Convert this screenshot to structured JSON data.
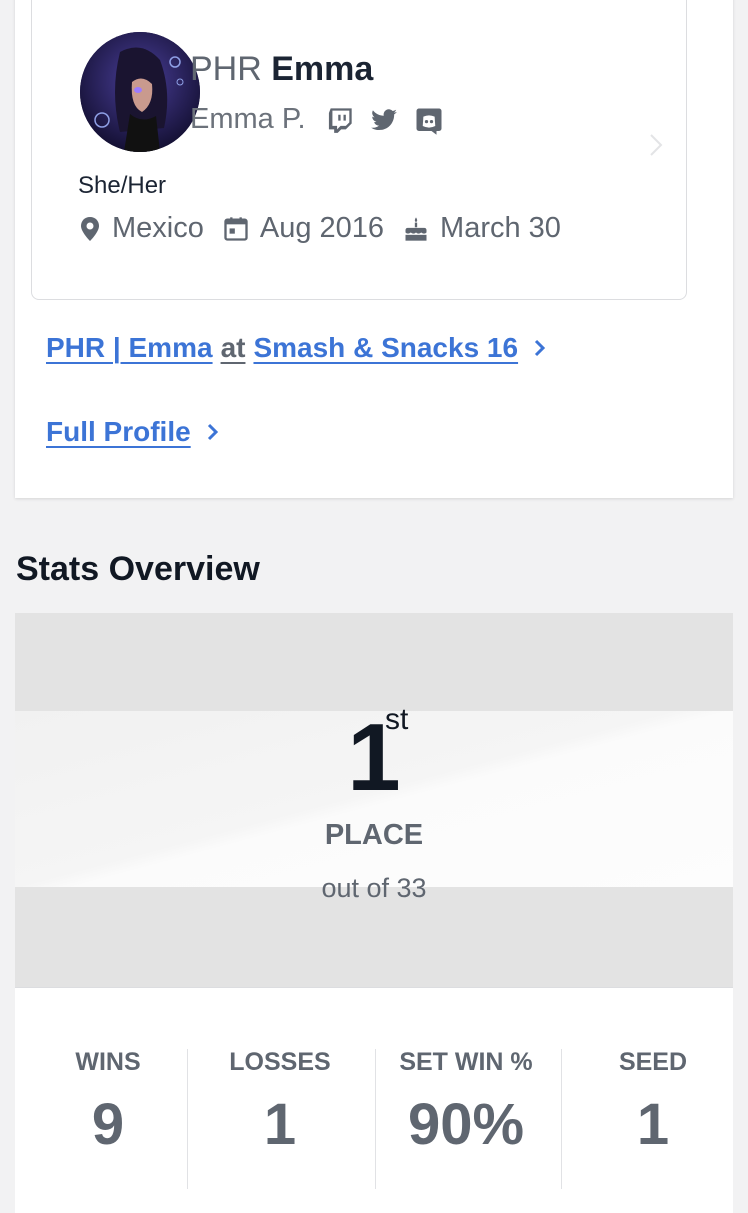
{
  "profile": {
    "prefix": "PHR",
    "gamertag": "Emma",
    "real_name": "Emma P.",
    "socials": [
      "twitch-icon",
      "twitter-icon",
      "discord-icon"
    ],
    "pronouns": "She/Her",
    "location": "Mexico",
    "joined": "Aug 2016",
    "birthday": "March 30"
  },
  "links": {
    "entrant_name": "PHR | Emma",
    "at": "at",
    "event_name": "Smash & Snacks 16",
    "full_profile": "Full Profile"
  },
  "stats": {
    "title": "Stats Overview",
    "place": "1",
    "place_suffix": "st",
    "place_label": "PLACE",
    "out_of": "out of 33",
    "items": [
      {
        "label": "WINS",
        "value": "9"
      },
      {
        "label": "LOSSES",
        "value": "1"
      },
      {
        "label": "SET WIN %",
        "value": "90%"
      },
      {
        "label": "SEED",
        "value": "1"
      }
    ]
  },
  "colors": {
    "link": "#3c74d6",
    "muted": "#5f6670",
    "dark": "#1b2433"
  }
}
